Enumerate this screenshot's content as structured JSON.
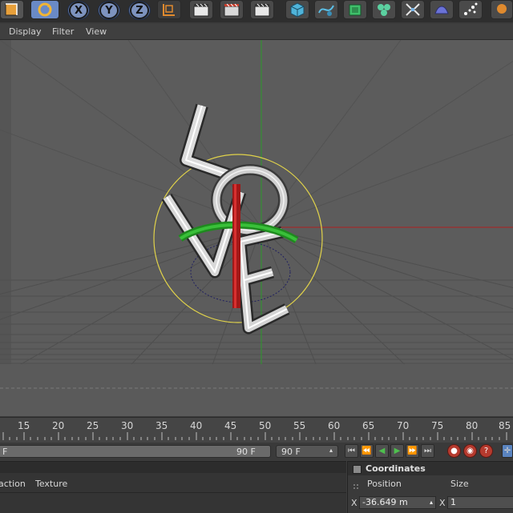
{
  "toolbar": {
    "axis_x": "X",
    "axis_y": "Y",
    "axis_z": "Z"
  },
  "menu": {
    "display": "Display",
    "filter": "Filter",
    "view": "View"
  },
  "timeline": {
    "ticks": [
      "15",
      "20",
      "25",
      "30",
      "35",
      "40",
      "45",
      "50",
      "55",
      "60",
      "65",
      "70",
      "75",
      "80",
      "85"
    ]
  },
  "framebar": {
    "start_frame": "F",
    "end_frame": "90 F",
    "max_frame": "90 F"
  },
  "left_panel": {
    "tab_action": "action",
    "tab_texture": "Texture"
  },
  "coordinates": {
    "title": "Coordinates",
    "position_label": "Position",
    "size_label": "Size",
    "x_label": "X",
    "position_x": "-36.649 m",
    "size_x_label": "X",
    "size_x": "1"
  },
  "colors": {
    "viewport_bg": "#5c5c5c",
    "axis_x": "#c0281e",
    "axis_y": "#2fae2f",
    "axis_z": "#3a4fb0",
    "selection_circle": "#e0d24a"
  }
}
